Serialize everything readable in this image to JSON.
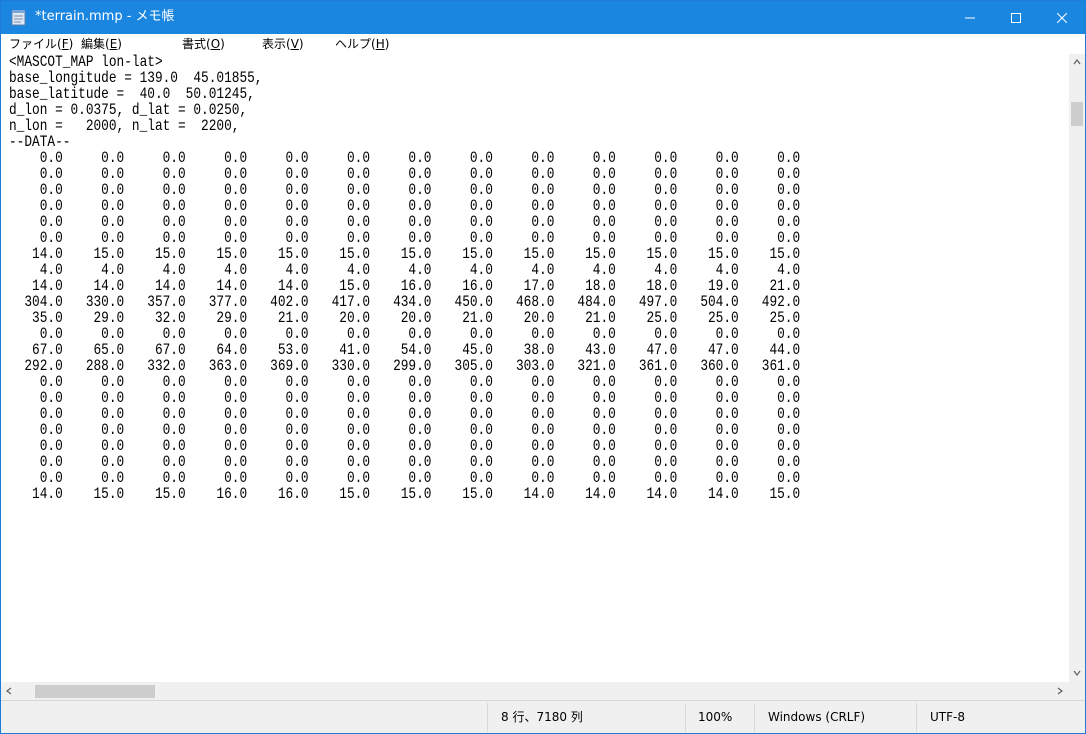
{
  "window": {
    "title": "*terrain.mmp - メモ帳",
    "titlebar_color": "#1a86e0"
  },
  "menu": {
    "items": [
      {
        "label": "ファイル(",
        "key": "F",
        "suffix": ")"
      },
      {
        "label": "編集(",
        "key": "E",
        "suffix": ")"
      },
      {
        "label": "書式(",
        "key": "O",
        "suffix": ")"
      },
      {
        "label": "表示(",
        "key": "V",
        "suffix": ")"
      },
      {
        "label": "ヘルプ(",
        "key": "H",
        "suffix": ")"
      }
    ]
  },
  "editor": {
    "lines": [
      "<MASCOT_MAP lon-lat>",
      "base_longitude = 139.0  45.01855,",
      "base_latitude =  40.0  50.01245,",
      "d_lon = 0.0375, d_lat = 0.0250,",
      "n_lon =   2000, n_lat =  2200,",
      "--DATA--",
      "    0.0     0.0     0.0     0.0     0.0     0.0     0.0     0.0     0.0     0.0     0.0     0.0     0.0",
      "    0.0     0.0     0.0     0.0     0.0     0.0     0.0     0.0     0.0     0.0     0.0     0.0     0.0",
      "    0.0     0.0     0.0     0.0     0.0     0.0     0.0     0.0     0.0     0.0     0.0     0.0     0.0",
      "    0.0     0.0     0.0     0.0     0.0     0.0     0.0     0.0     0.0     0.0     0.0     0.0     0.0",
      "    0.0     0.0     0.0     0.0     0.0     0.0     0.0     0.0     0.0     0.0     0.0     0.0     0.0",
      "    0.0     0.0     0.0     0.0     0.0     0.0     0.0     0.0     0.0     0.0     0.0     0.0     0.0",
      "   14.0    15.0    15.0    15.0    15.0    15.0    15.0    15.0    15.0    15.0    15.0    15.0    15.0",
      "    4.0     4.0     4.0     4.0     4.0     4.0     4.0     4.0     4.0     4.0     4.0     4.0     4.0",
      "   14.0    14.0    14.0    14.0    14.0    15.0    16.0    16.0    17.0    18.0    18.0    19.0    21.0",
      "  304.0   330.0   357.0   377.0   402.0   417.0   434.0   450.0   468.0   484.0   497.0   504.0   492.0",
      "   35.0    29.0    32.0    29.0    21.0    20.0    20.0    21.0    20.0    21.0    25.0    25.0    25.0",
      "    0.0     0.0     0.0     0.0     0.0     0.0     0.0     0.0     0.0     0.0     0.0     0.0     0.0",
      "   67.0    65.0    67.0    64.0    53.0    41.0    54.0    45.0    38.0    43.0    47.0    47.0    44.0",
      "  292.0   288.0   332.0   363.0   369.0   330.0   299.0   305.0   303.0   321.0   361.0   360.0   361.0",
      "    0.0     0.0     0.0     0.0     0.0     0.0     0.0     0.0     0.0     0.0     0.0     0.0     0.0",
      "    0.0     0.0     0.0     0.0     0.0     0.0     0.0     0.0     0.0     0.0     0.0     0.0     0.0",
      "    0.0     0.0     0.0     0.0     0.0     0.0     0.0     0.0     0.0     0.0     0.0     0.0     0.0",
      "    0.0     0.0     0.0     0.0     0.0     0.0     0.0     0.0     0.0     0.0     0.0     0.0     0.0",
      "    0.0     0.0     0.0     0.0     0.0     0.0     0.0     0.0     0.0     0.0     0.0     0.0     0.0",
      "    0.0     0.0     0.0     0.0     0.0     0.0     0.0     0.0     0.0     0.0     0.0     0.0     0.0",
      "    0.0     0.0     0.0     0.0     0.0     0.0     0.0     0.0     0.0     0.0     0.0     0.0     0.0",
      "   14.0    15.0    15.0    16.0    16.0    15.0    15.0    15.0    14.0    14.0    14.0    14.0    15.0"
    ]
  },
  "status": {
    "position": "8 行、7180 列",
    "zoom": "100%",
    "line_ending": "Windows (CRLF)",
    "encoding": "UTF-8"
  },
  "icons": {
    "app": "notepad-icon",
    "minimize": "minimize-icon",
    "maximize": "maximize-icon",
    "close": "close-icon"
  }
}
